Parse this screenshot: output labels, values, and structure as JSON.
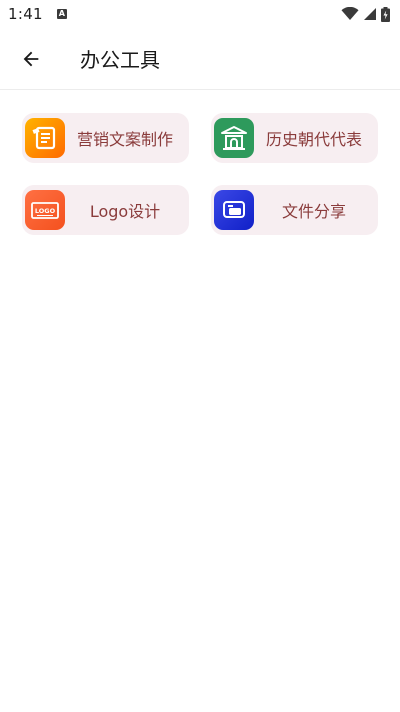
{
  "status": {
    "time": "1:41",
    "notification_glyph": "A",
    "icons": [
      "wifi-icon",
      "signal-icon",
      "battery-charging-icon"
    ]
  },
  "appbar": {
    "back_icon": "arrow-left-icon",
    "title": "办公工具"
  },
  "tools": [
    {
      "label": "营销文案制作",
      "icon": "marketing-copy-icon",
      "color": "#ff8a00"
    },
    {
      "label": "历史朝代代表",
      "icon": "ancient-building-icon",
      "color": "#2e9a5c"
    },
    {
      "label": "Logo设计",
      "icon": "logo-design-icon",
      "color": "#f4511e"
    },
    {
      "label": "文件分享",
      "icon": "file-share-icon",
      "color": "#1f2ed6"
    }
  ],
  "colors": {
    "card_bg": "#f7eef1",
    "label_text": "#8a3b3b"
  },
  "logo_icon_text": "LOGO"
}
